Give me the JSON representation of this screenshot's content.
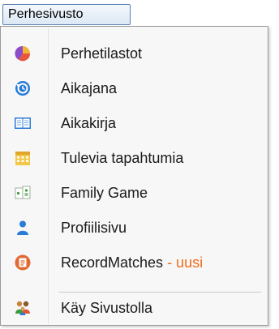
{
  "menu_button": {
    "label": "Perhesivusto"
  },
  "menu": {
    "items": [
      {
        "label": "Perhetilastot",
        "icon": "pie-chart-icon"
      },
      {
        "label": "Aikajana",
        "icon": "timeline-icon"
      },
      {
        "label": "Aikakirja",
        "icon": "book-icon"
      },
      {
        "label": "Tulevia tapahtumia",
        "icon": "calendar-icon"
      },
      {
        "label": "Family Game",
        "icon": "game-card-icon"
      },
      {
        "label": "Profiilisivu",
        "icon": "person-icon"
      },
      {
        "label": "RecordMatches",
        "badge": " - uusi",
        "icon": "record-icon"
      },
      {
        "label": "Käy Sivustolla",
        "icon": "family-icon"
      }
    ]
  },
  "colors": {
    "badge": "#f06a1a",
    "accent_blue": "#2a7bd6",
    "orange": "#e06a34"
  }
}
